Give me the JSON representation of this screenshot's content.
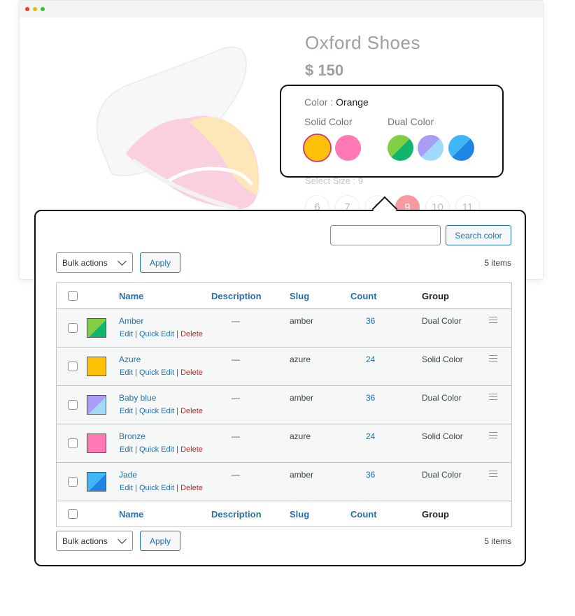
{
  "product": {
    "title": "Oxford Shoes",
    "price": "$ 150",
    "color_label": "Color :",
    "color_value": "Orange",
    "solid_label": "Solid Color",
    "dual_label": "Dual Color",
    "size_label": "Select Size : 9",
    "sizes": [
      "6",
      "7",
      "8",
      "9",
      "10",
      "11"
    ],
    "selected_size": "9"
  },
  "swatches": {
    "solid": [
      {
        "name": "Amber",
        "colors": [
          "#ffc107"
        ],
        "selected": true
      },
      {
        "name": "Bronze",
        "colors": [
          "#ff79b4"
        ]
      }
    ],
    "dual": [
      {
        "name": "Amber",
        "colors": [
          "#83cf44",
          "#10b66d"
        ]
      },
      {
        "name": "Baby blue",
        "colors": [
          "#a89cf6",
          "#9fdafd"
        ]
      },
      {
        "name": "Jade",
        "colors": [
          "#3fb7f6",
          "#1e85e4"
        ]
      }
    ]
  },
  "admin": {
    "search_button": "Search color",
    "bulk_actions": "Bulk actions",
    "apply": "Apply",
    "items_count": "5 items",
    "columns": {
      "name": "Name",
      "description": "Description",
      "slug": "Slug",
      "count": "Count",
      "group": "Group"
    },
    "row_actions": {
      "edit": "Edit",
      "quick_edit": "Quick Edit",
      "delete": "Delete",
      "sep": "|"
    },
    "rows": [
      {
        "name": "Amber",
        "description": "—",
        "slug": "amber",
        "count": "36",
        "group": "Dual Color",
        "colors": [
          "#83cf44",
          "#10b66d"
        ]
      },
      {
        "name": "Azure",
        "description": "—",
        "slug": "azure",
        "count": "24",
        "group": "Solid Color",
        "colors": [
          "#ffc107"
        ]
      },
      {
        "name": "Baby blue",
        "description": "—",
        "slug": "amber",
        "count": "36",
        "group": "Dual Color",
        "colors": [
          "#a89cf6",
          "#9fdafd"
        ]
      },
      {
        "name": "Bronze",
        "description": "—",
        "slug": "azure",
        "count": "24",
        "group": "Solid Color",
        "colors": [
          "#ff79b4"
        ]
      },
      {
        "name": "Jade",
        "description": "—",
        "slug": "amber",
        "count": "36",
        "group": "Dual Color",
        "colors": [
          "#3fb7f6",
          "#1e85e4"
        ]
      }
    ]
  }
}
